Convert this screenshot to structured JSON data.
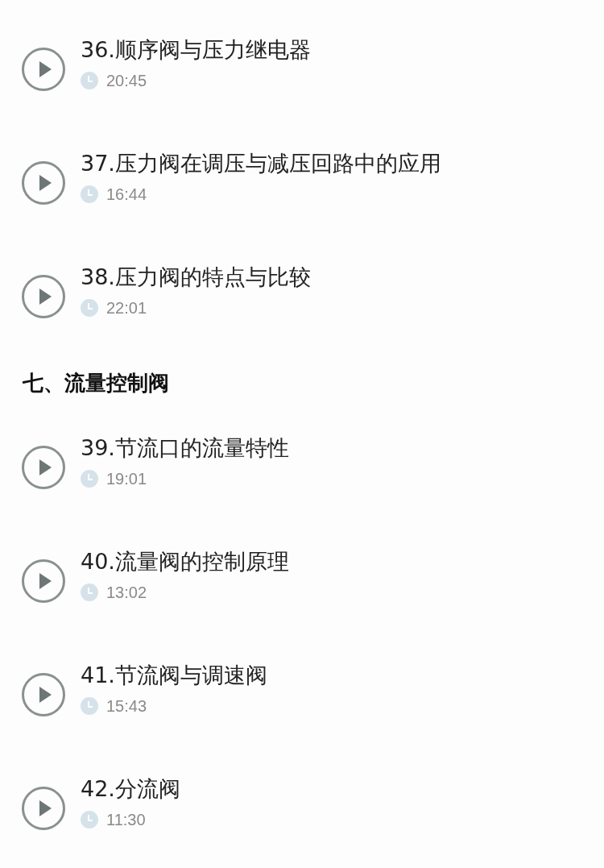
{
  "items": [
    {
      "kind": "lesson",
      "title": "36.顺序阀与压力继电器",
      "duration": "20:45"
    },
    {
      "kind": "lesson",
      "title": "37.压力阀在调压与减压回路中的应用",
      "duration": "16:44"
    },
    {
      "kind": "lesson",
      "title": "38.压力阀的特点与比较",
      "duration": "22:01"
    },
    {
      "kind": "section",
      "title": "七、流量控制阀"
    },
    {
      "kind": "lesson",
      "title": "39.节流口的流量特性",
      "duration": "19:01"
    },
    {
      "kind": "lesson",
      "title": "40.流量阀的控制原理",
      "duration": "13:02"
    },
    {
      "kind": "lesson",
      "title": "41.节流阀与调速阀",
      "duration": "15:43"
    },
    {
      "kind": "lesson",
      "title": "42.分流阀",
      "duration": "11:30"
    }
  ]
}
